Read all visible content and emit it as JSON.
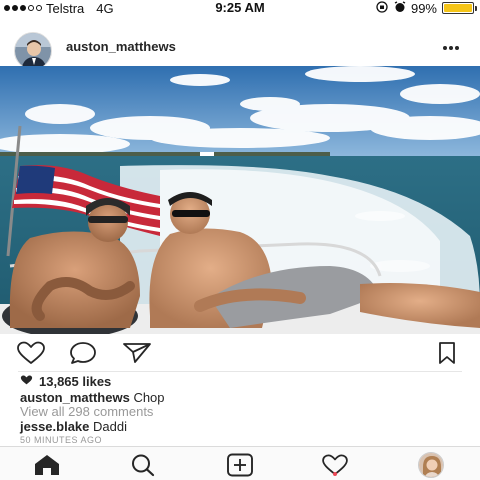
{
  "status_bar": {
    "carrier": "Telstra",
    "network": "4G",
    "time": "9:25 AM",
    "battery_percent": "99%",
    "battery_level": 0.99,
    "signal_bars_filled": 3,
    "signal_bars_total": 5
  },
  "post": {
    "username": "auston_matthews",
    "more_icon": "ellipsis-icon",
    "likes": "13,865 likes",
    "caption": {
      "username": "auston_matthews",
      "text": "Chop"
    },
    "view_all_comments": "View all 298 comments",
    "comments": [
      {
        "username": "jesse.blake",
        "text": "Daddi"
      }
    ],
    "timestamp": "50 MINUTES AGO"
  },
  "actions": {
    "like_icon": "heart-outline-icon",
    "comment_icon": "comment-bubble-icon",
    "share_icon": "send-icon",
    "bookmark_icon": "bookmark-icon"
  },
  "tab_bar": {
    "items": [
      {
        "icon": "home-icon",
        "active": true
      },
      {
        "icon": "search-icon",
        "active": false
      },
      {
        "icon": "add-post-icon",
        "active": false
      },
      {
        "icon": "activity-heart-icon",
        "active": false,
        "has_notification": true
      },
      {
        "icon": "profile-avatar",
        "active": false
      }
    ]
  },
  "colors": {
    "battery": "#f5c518",
    "notification": "#ed4956",
    "muted_text": "#999999",
    "text": "#262626"
  }
}
